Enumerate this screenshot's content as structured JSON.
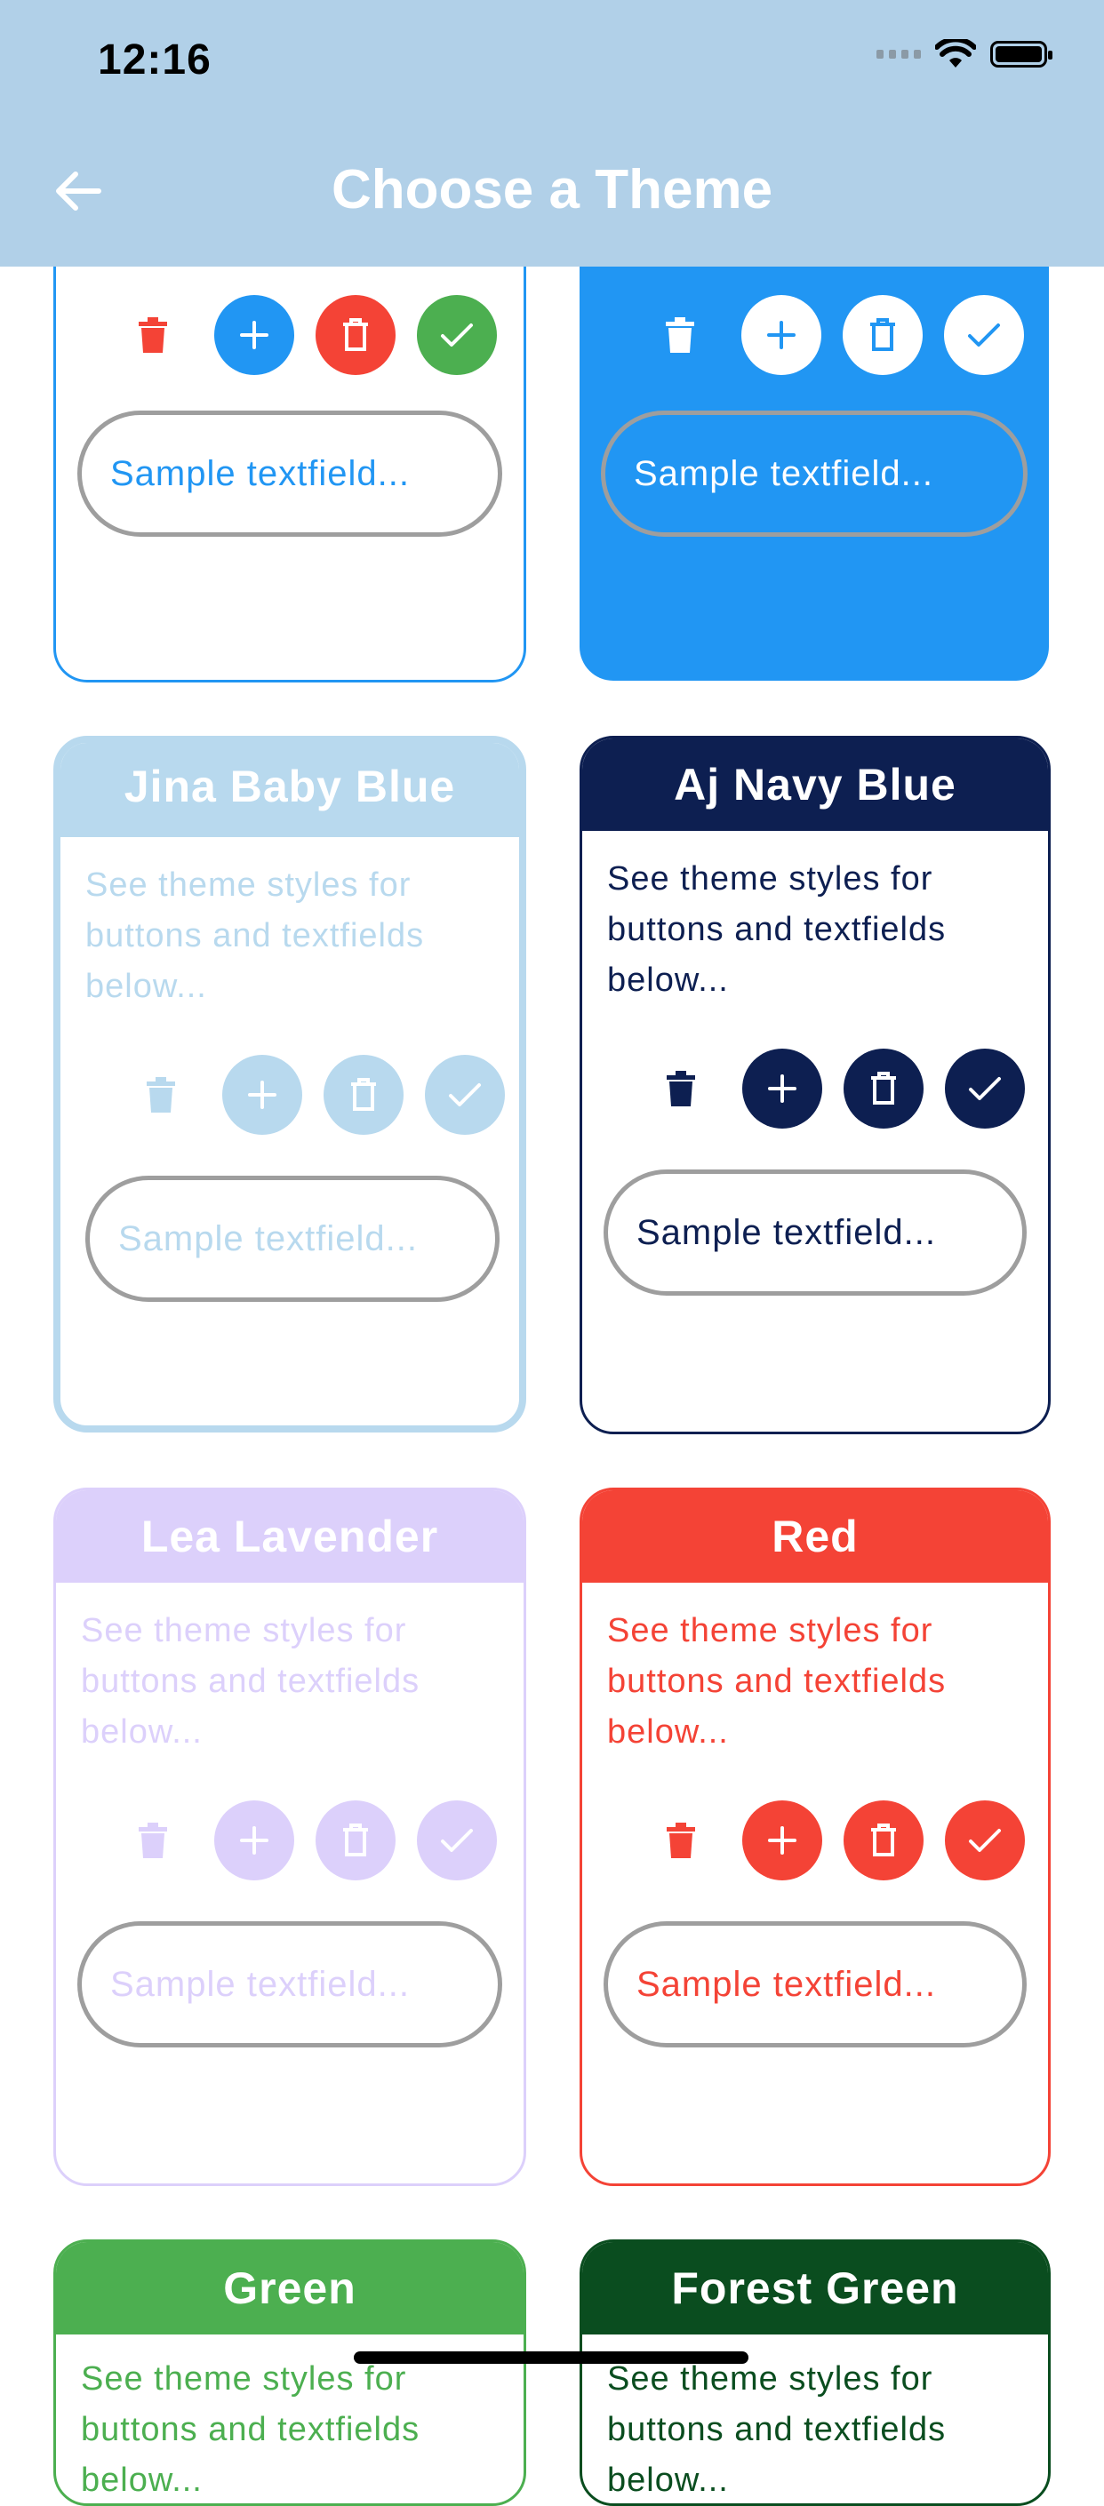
{
  "status_bar": {
    "time": "12:16"
  },
  "app_bar": {
    "title": "Choose a Theme"
  },
  "common": {
    "description": "See theme styles for buttons and textfields below...",
    "field_placeholder": "Sample textfield..."
  },
  "cards": [
    {
      "name": "",
      "colors": {
        "primary": "#2196f3",
        "success": "#4caf50",
        "danger": "#f44336"
      }
    },
    {
      "name": "",
      "colors": {
        "primary": "#2196f3",
        "on_primary": "#ffffff"
      }
    },
    {
      "name": "Jina Baby Blue",
      "colors": {
        "primary": "#b8d9ee"
      }
    },
    {
      "name": "Aj Navy Blue",
      "colors": {
        "primary": "#0d1f51"
      }
    },
    {
      "name": "Lea Lavender",
      "colors": {
        "primary": "#dcd0fb"
      }
    },
    {
      "name": "Red",
      "colors": {
        "primary": "#f44336"
      }
    },
    {
      "name": "Green",
      "colors": {
        "primary": "#4caf50"
      }
    },
    {
      "name": "Forest Green",
      "colors": {
        "primary": "#0a4d1f"
      }
    }
  ],
  "icons": [
    "back-arrow-icon",
    "delete-icon",
    "plus-icon",
    "trash-can-icon",
    "check-icon"
  ]
}
